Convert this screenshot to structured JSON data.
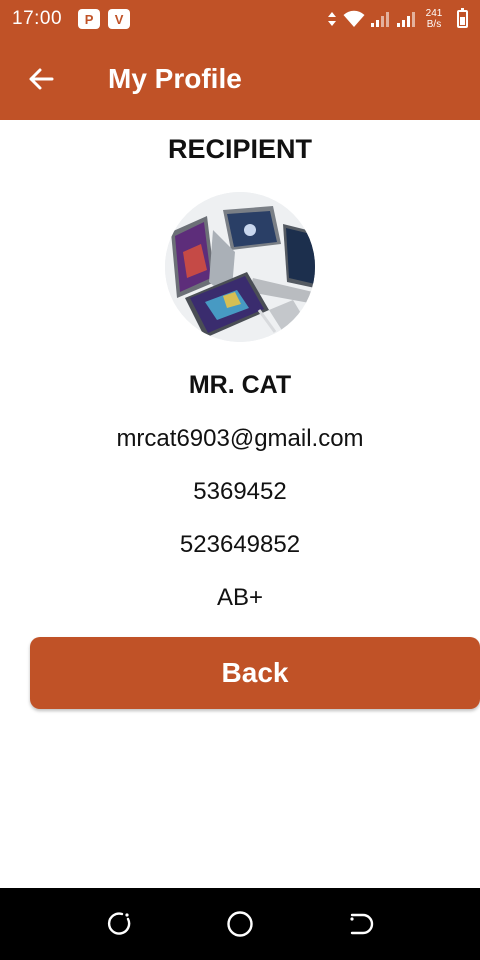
{
  "status_bar": {
    "time": "17:00",
    "badges": [
      "P",
      "V"
    ],
    "net_speed_value": "241",
    "net_speed_unit": "B/s"
  },
  "app_bar": {
    "title": "My Profile"
  },
  "profile": {
    "role": "RECIPIENT",
    "name": "MR. CAT",
    "email": "mrcat6903@gmail.com",
    "phone_1": "5369452",
    "phone_2": "523649852",
    "blood_group": "AB+"
  },
  "actions": {
    "back_label": "Back"
  },
  "colors": {
    "primary": "#c05227",
    "background": "#ffffff",
    "nav_bar": "#000000"
  }
}
